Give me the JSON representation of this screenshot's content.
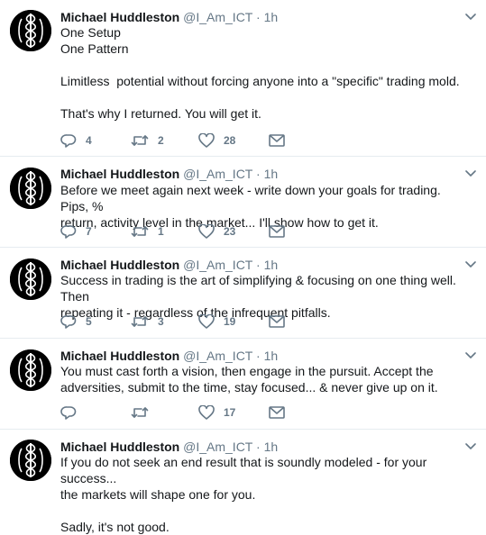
{
  "tweets": [
    {
      "name": "Michael Huddleston",
      "handle": "@I_Am_ICT",
      "time": "1h",
      "text": "One Setup\nOne Pattern\n\nLimitless  potential without forcing anyone into a \"specific\" trading mold.\n\nThat's why I returned. You will get it.",
      "replies": "4",
      "retweets": "2",
      "likes": "28"
    },
    {
      "name": "Michael Huddleston",
      "handle": "@I_Am_ICT",
      "time": "1h",
      "text": "Before we meet again next week - write down your goals for trading. Pips, %\nreturn, activity level in the market... I'll show how to get it.",
      "replies": "7",
      "retweets": "1",
      "likes": "23"
    },
    {
      "name": "Michael Huddleston",
      "handle": "@I_Am_ICT",
      "time": "1h",
      "text": "Success in trading is the art of simplifying & focusing on one thing well. Then\nrepeating it - regardless of the infrequent pitfalls.",
      "replies": "5",
      "retweets": "3",
      "likes": "19"
    },
    {
      "name": "Michael Huddleston",
      "handle": "@I_Am_ICT",
      "time": "1h",
      "text": "You must cast forth a vision, then engage in the pursuit. Accept the\nadversities, submit to the time, stay focused... & never give up on it.",
      "replies": "",
      "retweets": "",
      "likes": "17"
    },
    {
      "name": "Michael Huddleston",
      "handle": "@I_Am_ICT",
      "time": "1h",
      "text": "If you do not seek an end result that is soundly modeled - for your success...\nthe markets will shape one for you.\n\nSadly, it's not good."
    }
  ],
  "icons": {
    "reply": "reply-icon",
    "retweet": "retweet-icon",
    "like": "heart-icon",
    "dm": "envelope-icon",
    "more": "chevron-down-icon"
  },
  "colors": {
    "text": "#14171a",
    "muted": "#657786",
    "divider": "#e6ecf0"
  }
}
